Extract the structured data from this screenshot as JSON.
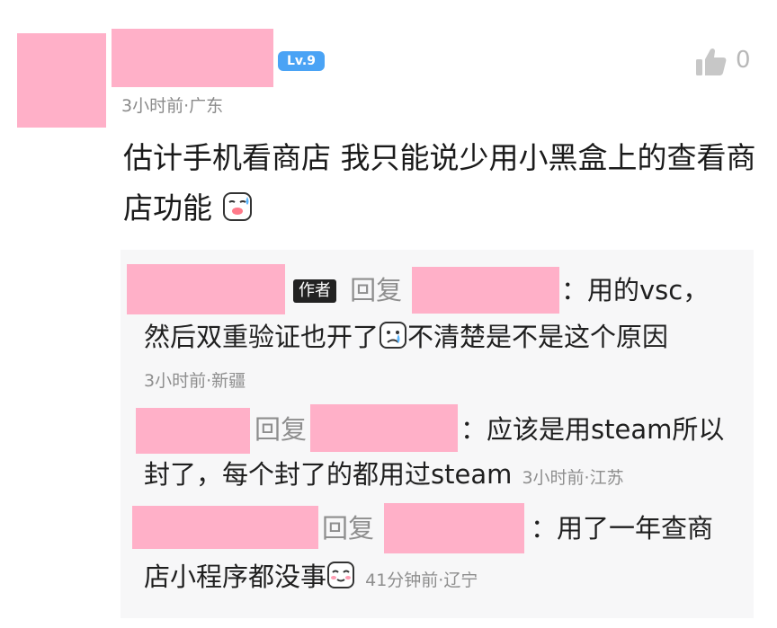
{
  "comment": {
    "level_badge": "Lv.9",
    "like_count": "0",
    "time_location": "3小时前·广东",
    "text": "估计手机看商店 我只能说少用小黑盒上的查看商店功能"
  },
  "replies": [
    {
      "author_tag": "作者",
      "reply_word": "回复",
      "text_a": "：用的vsc，",
      "text_b": "然后双重验证也开了",
      "text_c": "不清楚是不是这个原因",
      "meta": "3小时前·新疆"
    },
    {
      "reply_word": "回复",
      "text_a": "：应该是用steam所以",
      "text_b": "封了，每个封了的都用过steam",
      "meta": "3小时前·江苏"
    },
    {
      "reply_word": "回复",
      "text_a": "：用了一年查商",
      "text_b": "店小程序都没事",
      "meta": "41分钟前·辽宁"
    }
  ],
  "colors": {
    "redaction": "#ffb0c8",
    "level_badge": "#4aa3f5",
    "reply_bg": "#f7f7f8"
  },
  "icons": [
    "thumbs-up-icon",
    "sweat-emoji-icon",
    "crying-emoji-icon",
    "shy-emoji-icon"
  ]
}
